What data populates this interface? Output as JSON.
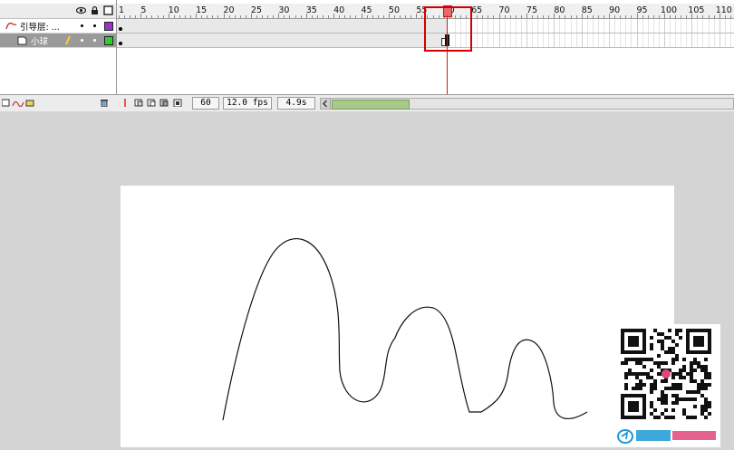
{
  "layers": [
    {
      "name": "引导层: ...",
      "type": "guide",
      "color": "#9933cc"
    },
    {
      "name": "小球",
      "type": "normal",
      "color": "#33cc33",
      "selected": true
    }
  ],
  "header_icons": [
    "eye-icon",
    "lock-icon",
    "outline-icon"
  ],
  "ruler_labels": [
    "1",
    "5",
    "10",
    "15",
    "20",
    "25",
    "30",
    "35",
    "40",
    "45",
    "50",
    "55",
    "60",
    "65",
    "70",
    "75",
    "80",
    "85",
    "90",
    "95",
    "100",
    "105",
    "110"
  ],
  "current_frame": "60",
  "frame_rate": "12.0 fps",
  "elapsed_time": "4.9s",
  "colors": {
    "playhead": "#e01515",
    "highlight": "#d40000",
    "accent_green": "#a8c88c"
  },
  "stage_path_desc": "motion guide line"
}
